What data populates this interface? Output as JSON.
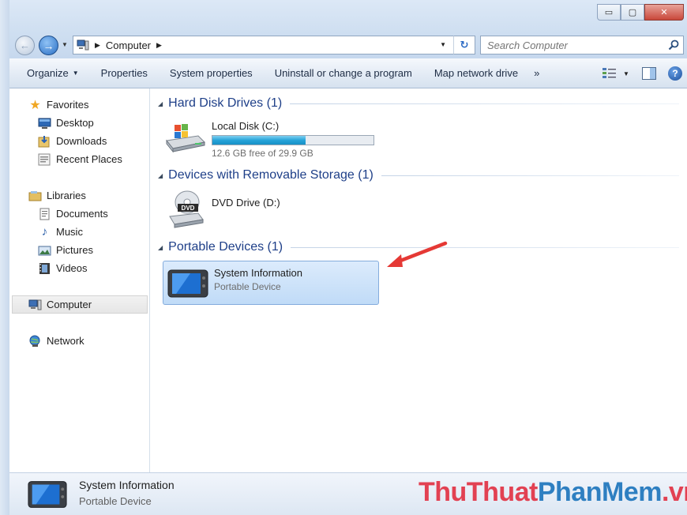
{
  "window": {
    "minimize_glyph": "▭",
    "maximize_glyph": "▢",
    "close_glyph": "✕"
  },
  "address": {
    "crumbs": [
      "Computer"
    ],
    "search_placeholder": "Search Computer"
  },
  "toolbar": {
    "organize": "Organize",
    "properties": "Properties",
    "system_properties": "System properties",
    "uninstall": "Uninstall or change a program",
    "map_drive": "Map network drive",
    "more": "»"
  },
  "nav": {
    "favorites": "Favorites",
    "favorites_items": [
      "Desktop",
      "Downloads",
      "Recent Places"
    ],
    "libraries": "Libraries",
    "libraries_items": [
      "Documents",
      "Music",
      "Pictures",
      "Videos"
    ],
    "computer": "Computer",
    "network": "Network"
  },
  "content": {
    "groups": [
      {
        "title": "Hard Disk Drives (1)"
      },
      {
        "title": "Devices with Removable Storage (1)"
      },
      {
        "title": "Portable Devices (1)"
      }
    ],
    "local_disk": {
      "name": "Local Disk (C:)",
      "free": "12.6 GB free of 29.9 GB",
      "used_fraction": 0.58
    },
    "dvd": {
      "name": "DVD Drive (D:)",
      "icon_label": "DVD"
    },
    "portable": {
      "name": "System Information",
      "sub": "Portable Device"
    }
  },
  "details": {
    "name": "System Information",
    "sub": "Portable Device"
  },
  "watermark": {
    "part1": "ThuThuat",
    "part2": "PhanMem",
    "part3": ".vn"
  },
  "colors": {
    "accent_blue": "#1e3f88",
    "progress_fill": "#27a4d9",
    "selection": "#c0dbf7",
    "arrow_red": "#e53935"
  }
}
